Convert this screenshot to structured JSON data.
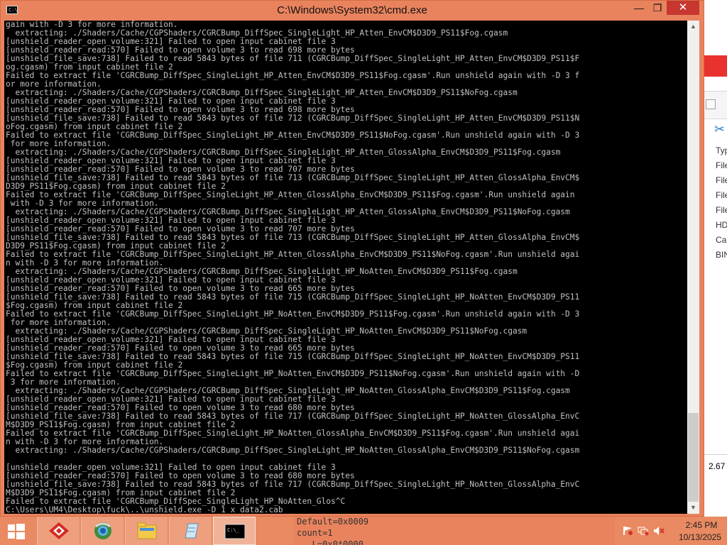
{
  "window": {
    "title": "C:\\Windows\\System32\\cmd.exe",
    "icon_text": "C:\\_",
    "minimize": "—",
    "maximize": "❐",
    "close": "✕"
  },
  "console": {
    "lines": [
      "gain with -D 3 for more information.",
      "  extracting: ./Shaders/Cache/CGPShaders/CGRCBump_DiffSpec_SingleLight_HP_Atten_EnvCM$D3D9_PS11$Fog.cgasm",
      "[unshield_reader_open_volume:321] Failed to open input cabinet file 3",
      "[unshield_reader_read:570] Failed to open volume 3 to read 698 more bytes",
      "[unshield_file_save:738] Failed to read 5843 bytes of file 711 (CGRCBump_DiffSpec_SingleLight_HP_Atten_EnvCM$D3D9_PS11$F",
      "og.cgasm) from input cabinet file 2",
      "Failed to extract file 'CGRCBump_DiffSpec_SingleLight_HP_Atten_EnvCM$D3D9_PS11$Fog.cgasm'.Run unshield again with -D 3 f",
      "or more information.",
      "  extracting: ./Shaders/Cache/CGPShaders/CGRCBump_DiffSpec_SingleLight_HP_Atten_EnvCM$D3D9_PS11$NoFog.cgasm",
      "[unshield_reader_open_volume:321] Failed to open input cabinet file 3",
      "[unshield_reader_read:570] Failed to open volume 3 to read 698 more bytes",
      "[unshield_file_save:738] Failed to read 5843 bytes of file 712 (CGRCBump_DiffSpec_SingleLight_HP_Atten_EnvCM$D3D9_PS11$N",
      "oFog.cgasm) from input cabinet file 2",
      "Failed to extract file 'CGRCBump_DiffSpec_SingleLight_HP_Atten_EnvCM$D3D9_PS11$NoFog.cgasm'.Run unshield again with -D 3",
      " for more information.",
      "  extracting: ./Shaders/Cache/CGPShaders/CGRCBump_DiffSpec_SingleLight_HP_Atten_GlossAlpha_EnvCM$D3D9_PS11$Fog.cgasm",
      "[unshield_reader_open_volume:321] Failed to open input cabinet file 3",
      "[unshield_reader_read:570] Failed to open volume 3 to read 707 more bytes",
      "[unshield_file_save:738] Failed to read 5843 bytes of file 713 (CGRCBump_DiffSpec_SingleLight_HP_Atten_GlossAlpha_EnvCM$",
      "D3D9_PS11$Fog.cgasm) from input cabinet file 2",
      "Failed to extract file 'CGRCBump_DiffSpec_SingleLight_HP_Atten_GlossAlpha_EnvCM$D3D9_PS11$Fog.cgasm'.Run unshield again",
      " with -D 3 for more information.",
      "  extracting: ./Shaders/Cache/CGPShaders/CGRCBump_DiffSpec_SingleLight_HP_Atten_GlossAlpha_EnvCM$D3D9_PS11$NoFog.cgasm",
      "[unshield_reader_open_volume:321] Failed to open input cabinet file 3",
      "[unshield_reader_read:570] Failed to open volume 3 to read 707 more bytes",
      "[unshield_file_save:738] Failed to read 5843 bytes of file 713 (CGRCBump_DiffSpec_SingleLight_HP_Atten_GlossAlpha_EnvCM$",
      "D3D9_PS11$Fog.cgasm) from input cabinet file 2",
      "Failed to extract file 'CGRCBump_DiffSpec_SingleLight_HP_Atten_GlossAlpha_EnvCM$D3D9_PS11$NoFog.cgasm'.Run unshield agai",
      "n with -D 3 for more information.",
      "  extracting: ./Shaders/Cache/CGPShaders/CGRCBump_DiffSpec_SingleLight_HP_NoAtten_EnvCM$D3D9_PS11$Fog.cgasm",
      "[unshield_reader_open_volume:321] Failed to open input cabinet file 3",
      "[unshield_reader_read:570] Failed to open volume 3 to read 665 more bytes",
      "[unshield_file_save:738] Failed to read 5843 bytes of file 715 (CGRCBump_DiffSpec_SingleLight_HP_NoAtten_EnvCM$D3D9_PS11",
      "$Fog.cgasm) from input cabinet file 2",
      "Failed to extract file 'CGRCBump_DiffSpec_SingleLight_HP_NoAtten_EnvCM$D3D9_PS11$Fog.cgasm'.Run unshield again with -D 3",
      " for more information.",
      "  extracting: ./Shaders/Cache/CGPShaders/CGRCBump_DiffSpec_SingleLight_HP_NoAtten_EnvCM$D3D9_PS11$NoFog.cgasm",
      "[unshield_reader_open_volume:321] Failed to open input cabinet file 3",
      "[unshield_reader_read:570] Failed to open volume 3 to read 665 more bytes",
      "[unshield_file_save:738] Failed to read 5843 bytes of file 715 (CGRCBump_DiffSpec_SingleLight_HP_NoAtten_EnvCM$D3D9_PS11",
      "$Fog.cgasm) from input cabinet file 2",
      "Failed to extract file 'CGRCBump_DiffSpec_SingleLight_HP_NoAtten_EnvCM$D3D9_PS11$NoFog.cgasm'.Run unshield again with -D",
      " 3 for more information.",
      "  extracting: ./Shaders/Cache/CGPShaders/CGRCBump_DiffSpec_SingleLight_HP_NoAtten_GlossAlpha_EnvCM$D3D9_PS11$Fog.cgasm",
      "[unshield_reader_open_volume:321] Failed to open input cabinet file 3",
      "[unshield_reader_read:570] Failed to open volume 3 to read 680 more bytes",
      "[unshield_file_save:738] Failed to read 5843 bytes of file 717 (CGRCBump_DiffSpec_SingleLight_HP_NoAtten_GlossAlpha_EnvC",
      "M$D3D9_PS11$Fog.cgasm) from input cabinet file 2",
      "Failed to extract file 'CGRCBump_DiffSpec_SingleLight_HP_NoAtten_GlossAlpha_EnvCM$D3D9_PS11$Fog.cgasm'.Run unshield agai",
      "n with -D 3 for more information.",
      "  extracting: ./Shaders/Cache/CGPShaders/CGRCBump_DiffSpec_SingleLight_HP_NoAtten_GlossAlpha_EnvCM$D3D9_PS11$NoFog.cgasm",
      "",
      "[unshield_reader_open_volume:321] Failed to open input cabinet file 3",
      "[unshield_reader_read:570] Failed to open volume 3 to read 680 more bytes",
      "[unshield_file_save:738] Failed to read 5843 bytes of file 717 (CGRCBump_DiffSpec_SingleLight_HP_NoAtten_GlossAlpha_EnvC",
      "M$D3D9_PS11$Fog.cgasm) from input cabinet file 2",
      "Failed to extract file 'CGRCBump_DiffSpec_SingleLight_HP_NoAtten_Glos^C",
      "C:\\Users\\UM4\\Desktop\\fuck\\..\\unshield.exe -D 1 x data2.cab"
    ]
  },
  "background_window": {
    "list_items": [
      "Typ",
      "File",
      "File",
      "File",
      "File",
      "HD",
      "Cal",
      "BIN"
    ],
    "value": "2.67"
  },
  "taskbar": {
    "preview_lines": [
      "Default=0x0009",
      "count=1",
      "   L=0x0*0000"
    ],
    "clock_time": "2:45 PM",
    "clock_date": "10/13/2025",
    "apps": [
      {
        "name": "adobe-app-icon"
      },
      {
        "name": "chrome-like-browser-icon"
      },
      {
        "name": "file-explorer-icon"
      },
      {
        "name": "notepad-icon"
      },
      {
        "name": "command-prompt-icon"
      }
    ]
  },
  "colors": {
    "accent": "#e9835e",
    "console_bg": "#000000",
    "console_fg": "#c0c0c0",
    "close_red": "#c7372f"
  }
}
